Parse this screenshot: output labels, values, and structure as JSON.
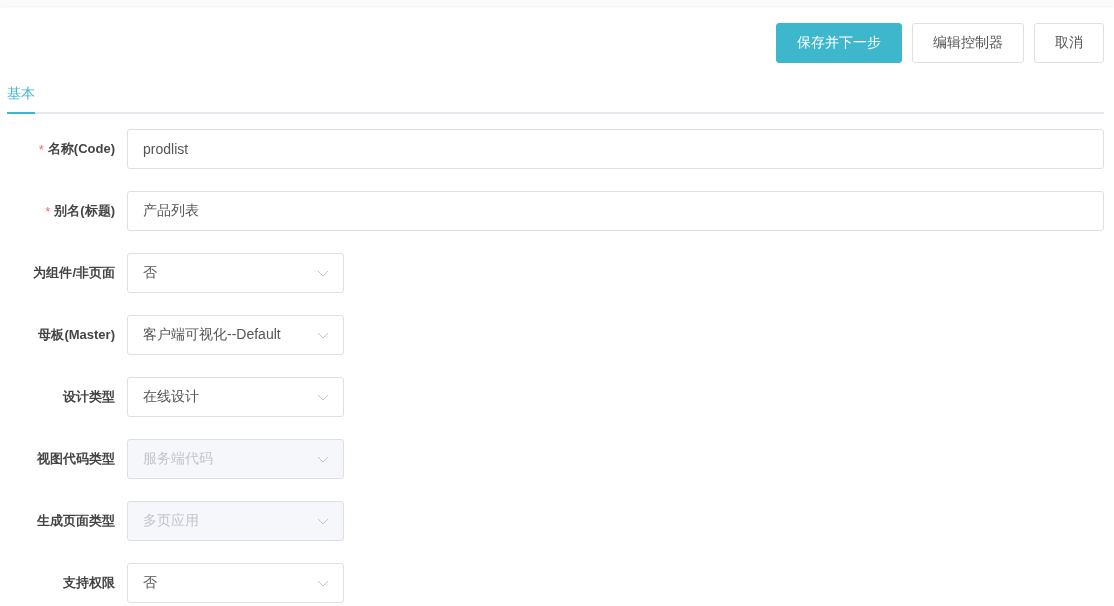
{
  "buttons": [
    {
      "label": "保存并下一步",
      "kind": "primary"
    },
    {
      "label": "编辑控制器",
      "kind": "default"
    },
    {
      "label": "取消",
      "kind": "default"
    }
  ],
  "tabs": [
    {
      "label": "基本",
      "selected": true
    }
  ],
  "fields": [
    {
      "label": "名称(Code)",
      "required_mark": "*",
      "kind": "text",
      "value": "prodlist",
      "disabled": false
    },
    {
      "label": "别名(标题)",
      "required_mark": "*",
      "kind": "text",
      "value": "产品列表",
      "disabled": false
    },
    {
      "label": "为组件/非页面",
      "kind": "select",
      "value": "否",
      "disabled": false
    },
    {
      "label": "母板(Master)",
      "kind": "select",
      "value": "客户端可视化--Default",
      "disabled": false
    },
    {
      "label": "设计类型",
      "kind": "select",
      "value": "在线设计",
      "disabled": false
    },
    {
      "label": "视图代码类型",
      "kind": "select",
      "value": "服务端代码",
      "disabled": true
    },
    {
      "label": "生成页面类型",
      "kind": "select",
      "value": "多页应用",
      "disabled": true
    },
    {
      "label": "支持权限",
      "kind": "select",
      "value": "否",
      "disabled": false
    }
  ]
}
